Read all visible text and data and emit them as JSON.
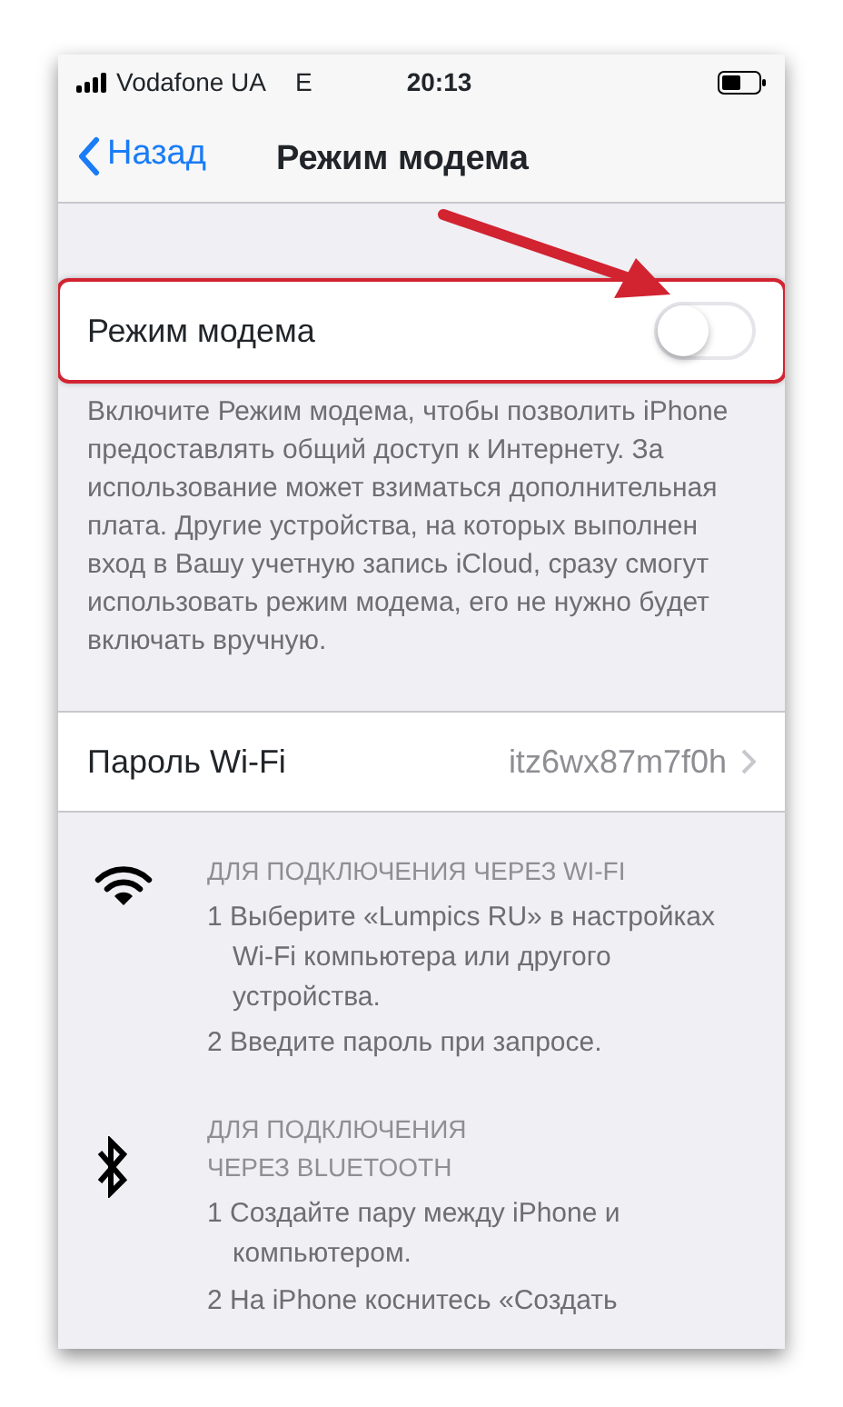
{
  "status_bar": {
    "carrier": "Vodafone UA",
    "network": "E",
    "time": "20:13"
  },
  "nav": {
    "back": "Назад",
    "title": "Режим модема"
  },
  "hotspot_toggle": {
    "label": "Режим модема",
    "on": false,
    "highlighted": true
  },
  "description": "Включите Режим модема, чтобы позволить iPhone предоставлять общий доступ к Интернету. За использование может взиматься дополнительная плата. Другие устройства, на которых выполнен вход в Вашу учетную запись iCloud, сразу смогут использовать режим модема, его не нужно будет включать вручную.",
  "wifi_password": {
    "label": "Пароль Wi-Fi",
    "value": "itz6wx87m7f0h"
  },
  "instructions": [
    {
      "kind": "wifi",
      "heading": "ДЛЯ ПОДКЛЮЧЕНИЯ ЧЕРЕЗ WI-FI",
      "steps": [
        "1 Выберите «Lumpics RU» в настройках Wi-Fi компьютера или другого устройства.",
        "2 Введите пароль при запросе."
      ]
    },
    {
      "kind": "bluetooth",
      "heading": "ДЛЯ ПОДКЛЮЧЕНИЯ ЧЕРЕЗ BLUETOOTH",
      "steps": [
        "1 Создайте пару между iPhone и компьютером.",
        "2 На iPhone коснитесь «Создать"
      ]
    }
  ]
}
